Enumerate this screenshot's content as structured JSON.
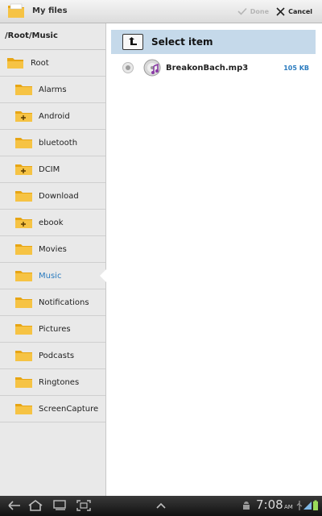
{
  "action_bar": {
    "title": "My files",
    "done_label": "Done",
    "cancel_label": "Cancel",
    "app_icon": "folder-icon",
    "done_icon": "check-icon",
    "cancel_icon": "close-icon"
  },
  "sidebar": {
    "path": "/Root/Music",
    "root": {
      "label": "Root",
      "icon": "open-folder-icon"
    },
    "items": [
      {
        "label": "Alarms",
        "icon": "folder-icon",
        "expandable": false
      },
      {
        "label": "Android",
        "icon": "folder-plus-icon",
        "expandable": true
      },
      {
        "label": "bluetooth",
        "icon": "folder-icon",
        "expandable": false
      },
      {
        "label": "DCIM",
        "icon": "folder-plus-icon",
        "expandable": true
      },
      {
        "label": "Download",
        "icon": "folder-icon",
        "expandable": false
      },
      {
        "label": "ebook",
        "icon": "folder-plus-icon",
        "expandable": true
      },
      {
        "label": "Movies",
        "icon": "folder-icon",
        "expandable": false
      },
      {
        "label": "Music",
        "icon": "folder-icon",
        "expandable": false,
        "selected": true
      },
      {
        "label": "Notifications",
        "icon": "folder-icon",
        "expandable": false
      },
      {
        "label": "Pictures",
        "icon": "folder-icon",
        "expandable": false
      },
      {
        "label": "Podcasts",
        "icon": "folder-icon",
        "expandable": false
      },
      {
        "label": "Ringtones",
        "icon": "folder-icon",
        "expandable": false
      },
      {
        "label": "ScreenCapture",
        "icon": "folder-icon",
        "expandable": false
      }
    ]
  },
  "main": {
    "header_title": "Select item",
    "header_icon": "up-arrow-icon",
    "files": [
      {
        "name": "BreakonBach.mp3",
        "size": "105 KB",
        "icon": "music-file-icon",
        "selected": false
      }
    ]
  },
  "status_bar": {
    "time": "7:08",
    "ampm": "AM",
    "icons": [
      "back-icon",
      "home-icon",
      "recent-apps-icon",
      "screenshot-icon",
      "chevron-up-icon",
      "android-icon",
      "usb-icon",
      "signal-icon",
      "battery-icon"
    ]
  },
  "colors": {
    "accent": "#2a7bbf",
    "header_bg": "#c5d9ea",
    "folder": "#f2b01e",
    "sidebar_bg": "#e9e9e9",
    "system_bar": "#1a1a1a"
  }
}
